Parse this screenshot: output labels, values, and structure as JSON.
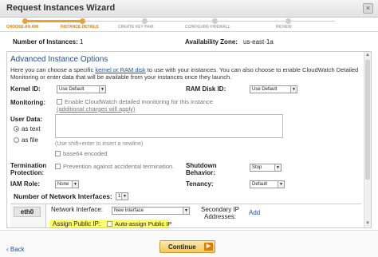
{
  "window": {
    "title": "Request Instances Wizard",
    "close_glyph": "×"
  },
  "steps": [
    {
      "label": "Choose an AMI",
      "state": "done"
    },
    {
      "label": "Instance Details",
      "state": "current"
    },
    {
      "label": "Create Key Pair",
      "state": "todo"
    },
    {
      "label": "Configure Firewall",
      "state": "todo"
    },
    {
      "label": "Review",
      "state": "todo"
    }
  ],
  "summary": {
    "instances_label": "Number of Instances:",
    "instances_value": "1",
    "az_label": "Availability Zone:",
    "az_value": "us-east-1a"
  },
  "advanced": {
    "title": "Advanced Instance Options",
    "desc_before": "Here you can choose a specific ",
    "desc_link": "kernel or RAM disk",
    "desc_after": " to use with your instances. You can also choose to enable CloudWatch Detailed Monitoring or enter data that will be available from your instances once they launch.",
    "kernel_label": "Kernel ID:",
    "kernel_value": "Use Default",
    "ramdisk_label": "RAM Disk ID:",
    "ramdisk_value": "Use Default",
    "monitoring_label": "Monitoring:",
    "monitoring_checkbox": "Enable CloudWatch detailed monitoring for this instance",
    "monitoring_charges": "(additional charges will apply)",
    "userdata_label": "User Data:",
    "as_text": "as text",
    "as_file": "as file",
    "newline_hint": "(Use shift+enter to insert a newline)",
    "base64": "base64 encoded",
    "termination_label": "Termination Protection:",
    "termination_checkbox": "Prevention against accidental termination.",
    "shutdown_label": "Shutdown Behavior:",
    "shutdown_value": "Stop",
    "iam_label": "IAM Role:",
    "iam_value": "None",
    "tenancy_label": "Tenancy:",
    "tenancy_value": "Default"
  },
  "network": {
    "count_label": "Number of Network Interfaces:",
    "count_value": "1",
    "tab": "eth0",
    "interface_label": "Network Interface:",
    "interface_value": "New Interface",
    "secondary_label": "Secondary IP Addresses:",
    "add": "Add",
    "public_ip_label": "Assign Public IP:",
    "public_ip_checkbox": "Auto-assign Public IP"
  },
  "footer": {
    "back": "Back",
    "continue": "Continue"
  },
  "colors": {
    "accent": "#f0a030",
    "link": "#1a4fb0",
    "highlight": "#ffff66"
  }
}
